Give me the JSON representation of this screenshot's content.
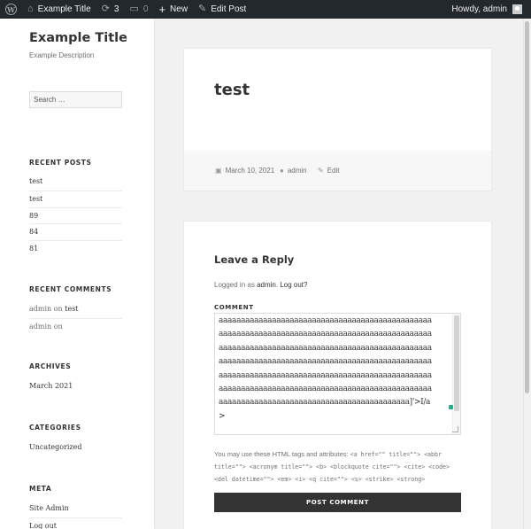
{
  "adminbar": {
    "site_name": "Example Title",
    "updates_count": "3",
    "comments_count": "0",
    "new_label": "New",
    "edit_post_label": "Edit Post",
    "howdy": "Howdy, admin"
  },
  "sidebar": {
    "site_title": "Example Title",
    "site_description": "Example Description",
    "search_placeholder": "Search …",
    "recent_posts": {
      "title": "RECENT POSTS",
      "items": [
        "test",
        "test",
        "89",
        "84",
        "81"
      ]
    },
    "recent_comments": {
      "title": "RECENT COMMENTS",
      "items": [
        {
          "author": "admin",
          "on": "on",
          "post": "test"
        },
        {
          "author": "admin",
          "on": "on",
          "post": ""
        }
      ]
    },
    "archives": {
      "title": "ARCHIVES",
      "items": [
        "March 2021"
      ]
    },
    "categories": {
      "title": "CATEGORIES",
      "items": [
        "Uncategorized"
      ]
    },
    "meta": {
      "title": "META",
      "items": [
        "Site Admin",
        "Log out"
      ]
    }
  },
  "post": {
    "title": "test",
    "date": "March 10, 2021",
    "author": "admin",
    "edit_label": "Edit"
  },
  "comment_form": {
    "title": "Leave a Reply",
    "logged_in_prefix": "Logged in as",
    "logged_in_user": "admin",
    "logged_in_sep": ".",
    "logout_label": "Log out?",
    "comment_label": "COMMENT",
    "textarea_lines": [
      "aaaaaaaaaaaaaaaaaaaaaaaaaaaaaaaaaaaaaaaaaaaaaaaa",
      "aaaaaaaaaaaaaaaaaaaaaaaaaaaaaaaaaaaaaaaaaaaaaaaa",
      "aaaaaaaaaaaaaaaaaaaaaaaaaaaaaaaaaaaaaaaaaaaaaaaa",
      "aaaaaaaaaaaaaaaaaaaaaaaaaaaaaaaaaaaaaaaaaaaaaaaa",
      "aaaaaaaaaaaaaaaaaaaaaaaaaaaaaaaaaaaaaaaaaaaaaaaa",
      "aaaaaaaaaaaaaaaaaaaaaaaaaaaaaaaaaaaaaaaaaaaaaaaa",
      "aaaaaaaaaaaaaaaaaaaaaaaaaaaaaaaaaaaaaaaaaaa]'>I/a",
      ">"
    ],
    "allowed_text": "You may use these HTML tags and attributes:",
    "allowed_code": "<a href=\"\" title=\"\"> <abbr title=\"\"> <acronym title=\"\"> <b> <blockquote cite=\"\"> <cite> <code> <del datetime=\"\"> <em> <i> <q cite=\"\"> <s> <strike> <strong>",
    "submit_label": "POST COMMENT"
  },
  "colors": {
    "adminbar": "#23282d",
    "button": "#333333",
    "accent_dot": "#1bb28a"
  },
  "icons": [
    "wordpress-logo-icon",
    "home-icon",
    "updates-icon",
    "comment-bubble-icon",
    "plus-icon",
    "pencil-icon",
    "calendar-icon",
    "user-icon",
    "edit-icon"
  ]
}
